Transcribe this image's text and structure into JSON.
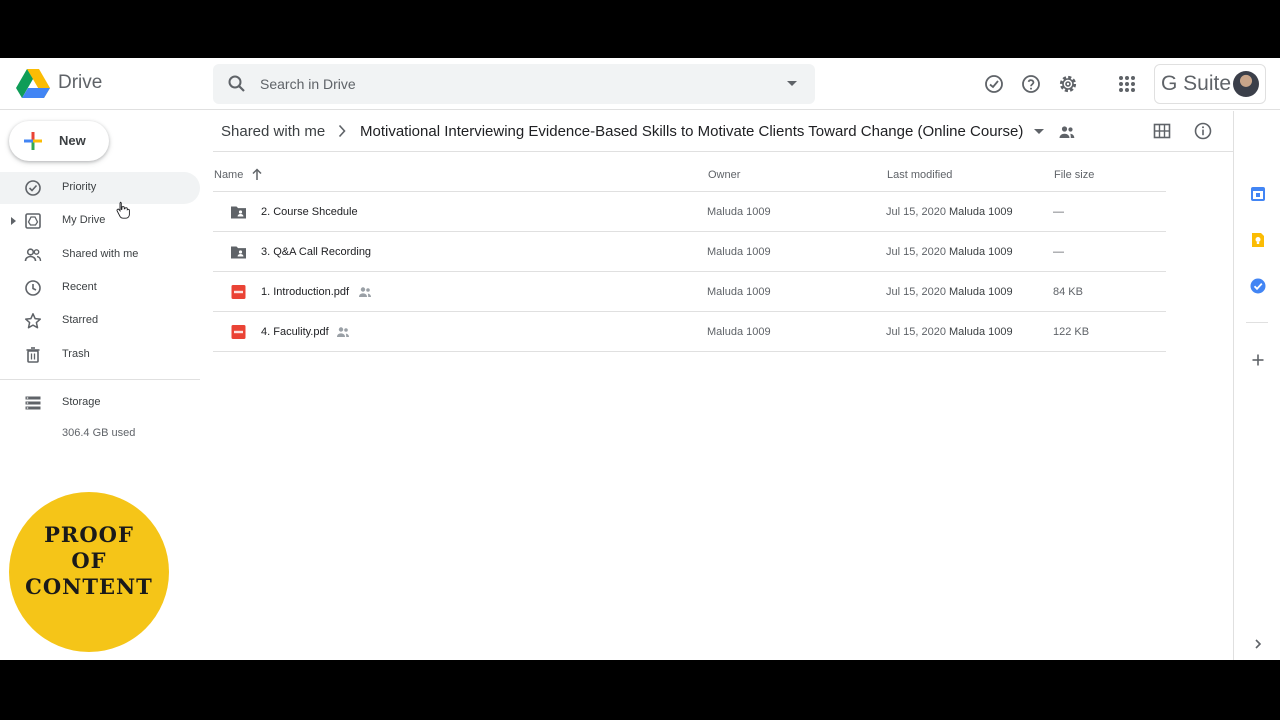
{
  "app": {
    "name": "Drive",
    "suite_label": "G Suite"
  },
  "search": {
    "placeholder": "Search in Drive"
  },
  "sidebar": {
    "new_label": "New",
    "items": [
      {
        "label": "Priority",
        "icon": "priority-icon"
      },
      {
        "label": "My Drive",
        "icon": "my-drive-icon"
      },
      {
        "label": "Shared with me",
        "icon": "people-icon"
      },
      {
        "label": "Recent",
        "icon": "clock-icon"
      },
      {
        "label": "Starred",
        "icon": "star-icon"
      },
      {
        "label": "Trash",
        "icon": "trash-icon"
      }
    ],
    "storage": {
      "label": "Storage",
      "used": "306.4 GB used"
    }
  },
  "breadcrumb": {
    "root": "Shared with me",
    "current": "Motivational Interviewing Evidence-Based Skills to Motivate Clients Toward Change (Online Course)"
  },
  "table": {
    "columns": {
      "name": "Name",
      "owner": "Owner",
      "modified": "Last modified",
      "size": "File size"
    },
    "rows": [
      {
        "name": "2. Course Shcedule",
        "type": "shared-folder",
        "shared": false,
        "owner": "Maluda 1009",
        "date": "Jul 15, 2020",
        "modified_by": "Maluda 1009",
        "size": "—"
      },
      {
        "name": "3. Q&A Call Recording",
        "type": "shared-folder",
        "shared": false,
        "owner": "Maluda 1009",
        "date": "Jul 15, 2020",
        "modified_by": "Maluda 1009",
        "size": "—"
      },
      {
        "name": "1. Introduction.pdf",
        "type": "pdf",
        "shared": true,
        "owner": "Maluda 1009",
        "date": "Jul 15, 2020",
        "modified_by": "Maluda 1009",
        "size": "84 KB"
      },
      {
        "name": "4. Faculity.pdf",
        "type": "pdf",
        "shared": true,
        "owner": "Maluda 1009",
        "date": "Jul 15, 2020",
        "modified_by": "Maluda 1009",
        "size": "122 KB"
      }
    ]
  },
  "badge": {
    "line1": "PROOF",
    "line2": "OF",
    "line3": "CONTENT"
  },
  "colors": {
    "accent_blue": "#1a73e8",
    "pdf_red": "#ea4335",
    "badge_yellow": "#f5c518",
    "calendar_blue": "#4285f4",
    "keep_yellow": "#fbbc04"
  }
}
